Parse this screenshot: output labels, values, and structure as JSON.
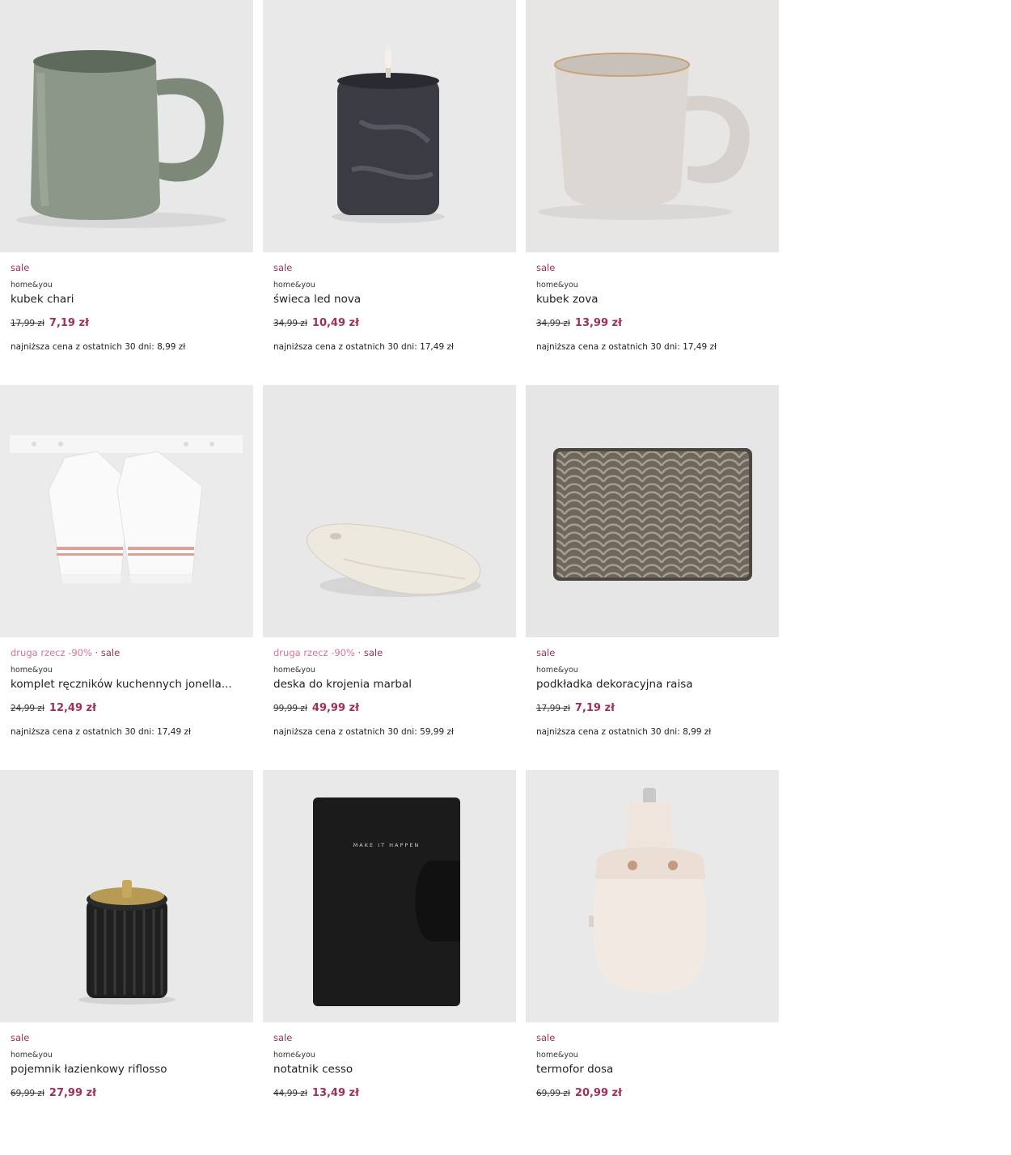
{
  "colors": {
    "sale": "#a0305a",
    "promo": "#d9729a",
    "image_bg": "#e7e7e7"
  },
  "products": [
    {
      "tag_promo": "",
      "tag_sale": "sale",
      "brand": "home&you",
      "name": "kubek chari",
      "old_price": "17,99 zł",
      "new_price": "7,19 zł",
      "lowest": "najniższa cena z ostatnich 30 dni: 8,99 zł",
      "image": "green-mug"
    },
    {
      "tag_promo": "",
      "tag_sale": "sale",
      "brand": "home&you",
      "name": "świeca led nova",
      "old_price": "34,99 zł",
      "new_price": "10,49 zł",
      "lowest": "najniższa cena z ostatnich 30 dni: 17,49 zł",
      "image": "led-candle"
    },
    {
      "tag_promo": "",
      "tag_sale": "sale",
      "brand": "home&you",
      "name": "kubek zova",
      "old_price": "34,99 zł",
      "new_price": "13,99 zł",
      "lowest": "najniższa cena z ostatnich 30 dni: 17,49 zł",
      "image": "beige-mug"
    },
    {
      "tag_promo": "druga rzecz -90%",
      "tag_sale": "sale",
      "brand": "home&you",
      "name": "komplet ręczników kuchennych jonella...",
      "old_price": "24,99 zł",
      "new_price": "12,49 zł",
      "lowest": "najniższa cena z ostatnich 30 dni: 17,49 zł",
      "image": "kitchen-towels"
    },
    {
      "tag_promo": "druga rzecz -90%",
      "tag_sale": "sale",
      "brand": "home&you",
      "name": "deska do krojenia marbal",
      "old_price": "99,99 zł",
      "new_price": "49,99 zł",
      "lowest": "najniższa cena z ostatnich 30 dni: 59,99 zł",
      "image": "marble-board"
    },
    {
      "tag_promo": "",
      "tag_sale": "sale",
      "brand": "home&you",
      "name": "podkładka dekoracyjna raisa",
      "old_price": "17,99 zł",
      "new_price": "7,19 zł",
      "lowest": "najniższa cena z ostatnich 30 dni: 8,99 zł",
      "image": "placemat"
    },
    {
      "tag_promo": "",
      "tag_sale": "sale",
      "brand": "home&you",
      "name": "pojemnik łazienkowy riflosso",
      "old_price": "69,99 zł",
      "new_price": "27,99 zł",
      "lowest": "",
      "image": "bathroom-container"
    },
    {
      "tag_promo": "",
      "tag_sale": "sale",
      "brand": "home&you",
      "name": "notatnik cesso",
      "old_price": "44,99 zł",
      "new_price": "13,49 zł",
      "lowest": "",
      "image": "notebook",
      "cover_text": "MAKE IT HAPPEN"
    },
    {
      "tag_promo": "",
      "tag_sale": "sale",
      "brand": "home&you",
      "name": "termofor dosa",
      "old_price": "69,99 zł",
      "new_price": "20,99 zł",
      "lowest": "",
      "image": "hot-water-bottle"
    }
  ]
}
